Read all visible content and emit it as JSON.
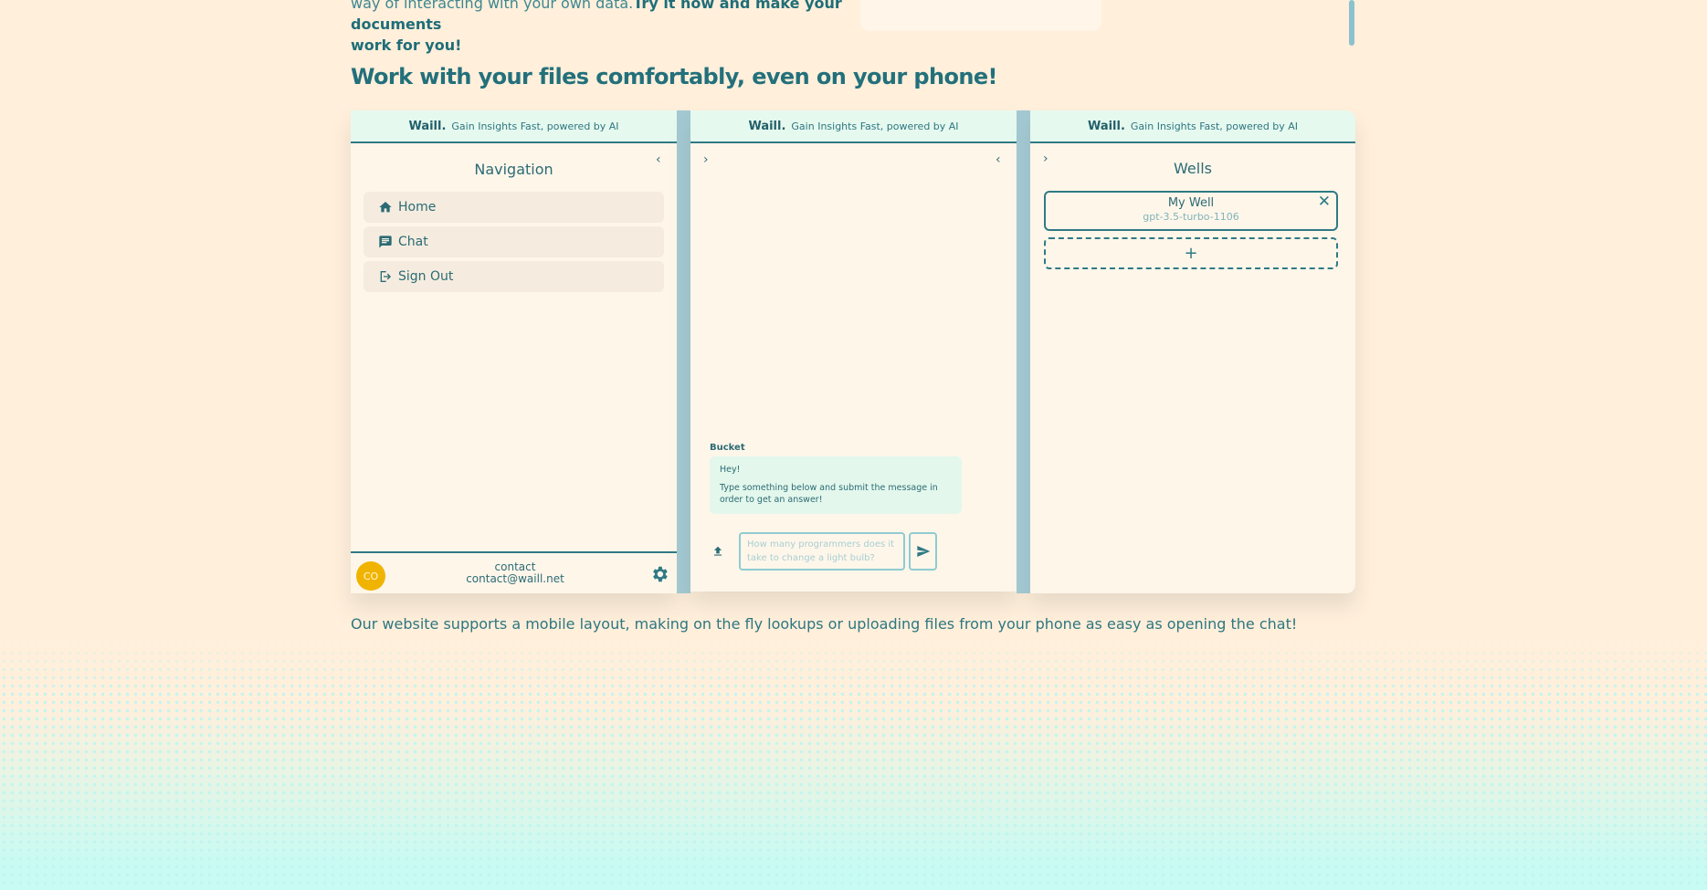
{
  "intro": {
    "line1_plain": "way of interacting with your own data.",
    "line1_bold": "Try it now and make your documents",
    "line2_bold": "work for you!"
  },
  "section": {
    "heading": "Work with your files comfortably, even on your phone!",
    "caption": "Our website supports a mobile layout, making on the fly lookups or uploading files from your phone as easy as opening the chat!"
  },
  "app_header": {
    "brand": "Waill.",
    "tagline": "Gain Insights Fast, powered by AI"
  },
  "navigation_panel": {
    "title": "Navigation",
    "items": [
      {
        "label": "Home",
        "icon": "home-icon"
      },
      {
        "label": "Chat",
        "icon": "chat-icon"
      },
      {
        "label": "Sign Out",
        "icon": "sign-out-icon"
      }
    ],
    "user": {
      "initials": "CO",
      "name": "contact",
      "email": "contact@waill.net"
    }
  },
  "chat_panel": {
    "sender": "Bucket",
    "message_line1": "Hey!",
    "message_line2": "Type something below and submit the message in order to get an answer!",
    "input_placeholder": "How many programmers does it take to change a light bulb?"
  },
  "wells_panel": {
    "title": "Wells",
    "wells": [
      {
        "name": "My Well",
        "model": "gpt-3.5-turbo-1106"
      }
    ],
    "add_label": "+"
  },
  "colors": {
    "background": "#ffefdb",
    "accent": "#2f7a84",
    "panel": "#fff6ea",
    "header": "#e6f9ef",
    "avatar": "#f0b400"
  }
}
